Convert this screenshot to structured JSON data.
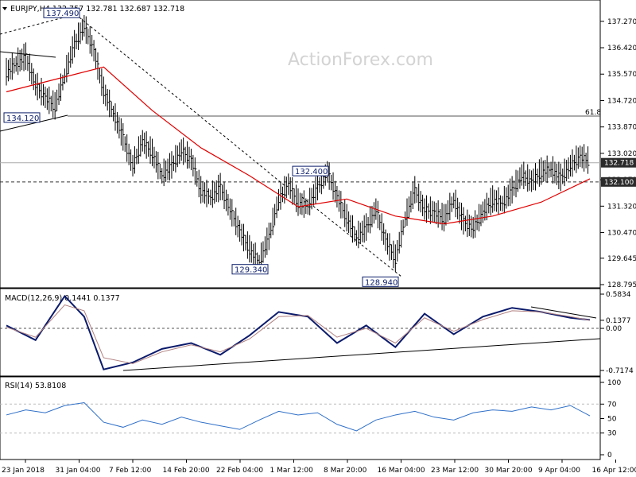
{
  "title": "EURJPY,H4  132.757 132.781 132.687 132.718",
  "watermark": "ActionForex.com",
  "colors": {
    "price_bars": "#000000",
    "sma": "#e00000",
    "macd": "#0a1a6b",
    "signal": "#b08080",
    "rsi": "#2e6fc8",
    "tag_bg": "#2b2b2b"
  },
  "chart_data": [
    {
      "type": "line",
      "panel": "price",
      "symbol": "EURJPY",
      "timeframe": "H4",
      "ohlc_header": {
        "open": 132.757,
        "high": 132.781,
        "low": 132.687,
        "close": 132.718
      },
      "ylim": [
        128.795,
        137.7
      ],
      "y_ticks": [
        "137.270",
        "136.420",
        "135.570",
        "134.720",
        "133.870",
        "133.020",
        "132.170",
        "131.320",
        "130.470",
        "129.645",
        "128.795"
      ],
      "x_ticks": [
        "23 Jan 2018",
        "31 Jan 04:00",
        "7 Feb 12:00",
        "14 Feb 20:00",
        "22 Feb 04:00",
        "1 Mar 12:00",
        "8 Mar 20:00",
        "16 Mar 04:00",
        "23 Mar 12:00",
        "30 Mar 20:00",
        "9 Apr 04:00",
        "16 Apr 12:00"
      ],
      "fib_level": {
        "label": "61.8",
        "value": 134.22
      },
      "horizontal_levels": [
        {
          "label": "132.718",
          "value": 132.718,
          "style": "solid"
        },
        {
          "label": "132.100",
          "value": 132.1,
          "style": "dashed"
        }
      ],
      "annotations": [
        {
          "label": "137.490",
          "value": 137.49
        },
        {
          "label": "134.120",
          "value": 134.12
        },
        {
          "label": "129.340",
          "value": 129.34
        },
        {
          "label": "132.400",
          "value": 132.4
        },
        {
          "label": "128.940",
          "value": 128.94
        }
      ],
      "series": [
        {
          "kind": "close",
          "x": [
            0,
            1,
            2,
            3,
            4,
            5,
            6,
            7,
            8,
            9,
            10,
            11,
            12,
            13,
            14,
            15,
            16,
            17,
            18,
            19,
            20,
            21,
            22,
            23,
            24,
            25,
            26,
            27,
            28,
            29,
            30,
            31,
            32,
            33,
            34,
            35,
            36,
            37,
            38,
            39,
            40,
            41,
            42,
            43,
            44,
            45,
            46,
            47,
            48,
            49,
            50,
            51,
            52,
            53,
            54,
            55,
            56,
            57,
            58,
            59,
            60
          ],
          "values": [
            135.6,
            135.9,
            136.1,
            135.2,
            134.8,
            134.5,
            135.5,
            136.5,
            137.1,
            136.3,
            135.0,
            134.3,
            133.5,
            132.6,
            133.4,
            133.0,
            132.3,
            132.6,
            133.1,
            132.8,
            131.8,
            131.6,
            131.9,
            131.2,
            130.5,
            129.9,
            129.5,
            130.3,
            131.5,
            132.0,
            131.4,
            131.3,
            131.9,
            132.4,
            131.6,
            130.9,
            130.3,
            130.6,
            131.2,
            130.2,
            129.6,
            130.9,
            131.8,
            131.2,
            131.1,
            130.9,
            131.5,
            130.8,
            130.6,
            131.1,
            131.5,
            131.4,
            131.8,
            132.3,
            132.1,
            132.4,
            132.5,
            132.2,
            132.6,
            132.9,
            132.718
          ]
        },
        {
          "kind": "sma",
          "x": [
            0,
            5,
            10,
            15,
            20,
            25,
            30,
            35,
            40,
            45,
            50,
            55,
            60
          ],
          "values": [
            135.0,
            135.4,
            135.8,
            134.4,
            133.2,
            132.3,
            131.3,
            131.55,
            131.0,
            130.75,
            131.0,
            131.45,
            132.2
          ]
        }
      ]
    },
    {
      "type": "line",
      "panel": "macd",
      "title": "MACD(12,26,9) 0.1441 0.1377",
      "ylim": [
        -0.7174,
        0.5834
      ],
      "y_ticks": [
        "0.5834",
        "0.1377",
        "0.00",
        "-0.7174"
      ],
      "series": [
        {
          "name": "MACD",
          "x": [
            0,
            3,
            6,
            8,
            10,
            13,
            16,
            19,
            22,
            25,
            28,
            31,
            34,
            37,
            40,
            43,
            46,
            49,
            52,
            55,
            58,
            60
          ],
          "values": [
            0.05,
            -0.2,
            0.55,
            0.2,
            -0.7,
            -0.58,
            -0.35,
            -0.25,
            -0.45,
            -0.12,
            0.28,
            0.2,
            -0.25,
            0.05,
            -0.32,
            0.25,
            -0.1,
            0.2,
            0.35,
            0.28,
            0.18,
            0.1441
          ]
        },
        {
          "name": "Signal",
          "x": [
            0,
            3,
            6,
            8,
            10,
            13,
            16,
            19,
            22,
            25,
            28,
            31,
            34,
            37,
            40,
            43,
            46,
            49,
            52,
            55,
            58,
            60
          ],
          "values": [
            0.02,
            -0.15,
            0.4,
            0.3,
            -0.5,
            -0.6,
            -0.4,
            -0.28,
            -0.4,
            -0.18,
            0.2,
            0.22,
            -0.15,
            0.0,
            -0.25,
            0.18,
            -0.05,
            0.15,
            0.3,
            0.28,
            0.2,
            0.1377
          ]
        }
      ]
    },
    {
      "type": "line",
      "panel": "rsi",
      "title": "RSI(14) 53.8108",
      "ylim": [
        0,
        100
      ],
      "y_ticks": [
        "100",
        "70",
        "50",
        "30",
        "0"
      ],
      "series": [
        {
          "name": "RSI",
          "x": [
            0,
            2,
            4,
            6,
            8,
            10,
            12,
            14,
            16,
            18,
            20,
            22,
            24,
            26,
            28,
            30,
            32,
            34,
            36,
            38,
            40,
            42,
            44,
            46,
            48,
            50,
            52,
            54,
            56,
            58,
            60
          ],
          "values": [
            55,
            62,
            58,
            68,
            72,
            45,
            38,
            48,
            42,
            52,
            45,
            40,
            35,
            48,
            60,
            55,
            58,
            42,
            33,
            48,
            55,
            60,
            52,
            48,
            58,
            62,
            60,
            66,
            62,
            68,
            53.8108
          ]
        }
      ]
    }
  ]
}
